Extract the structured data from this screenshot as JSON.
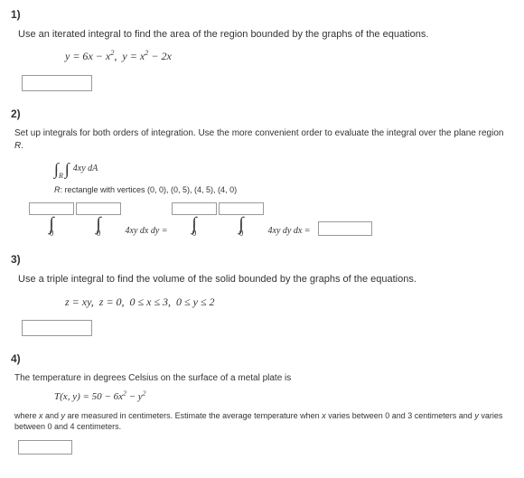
{
  "p1": {
    "num": "1)",
    "stmt": "Use an iterated integral to find the area of the region bounded by the graphs of the equations.",
    "eq": "y = 6x − x²,  y = x² − 2x"
  },
  "p2": {
    "num": "2)",
    "stmt": "Set up integrals for both orders of integration. Use the more convenient order to evaluate the integral over the plane region R.",
    "integrand": "4xy dA",
    "subR": "R",
    "region": "R: rectangle with vertices (0, 0), (0, 5), (4, 5), (4, 0)",
    "lower": "0",
    "mid1": " 4xy dx dy = ",
    "mid2": " 4xy dy dx = "
  },
  "p3": {
    "num": "3)",
    "stmt": "Use a triple integral to find the volume of the solid bounded by the graphs of the equations.",
    "eq": "z = xy,  z = 0,  0 ≤ x ≤ 3,  0 ≤ y ≤ 2"
  },
  "p4": {
    "num": "4)",
    "stmt": "The temperature in degrees Celsius on the surface of a metal plate is",
    "eq": "T(x, y) = 50 − 6x² − y²",
    "note": "where x and y are measured in centimeters. Estimate the average temperature when x varies between 0 and 3 centimeters and y varies between 0 and 4 centimeters."
  }
}
